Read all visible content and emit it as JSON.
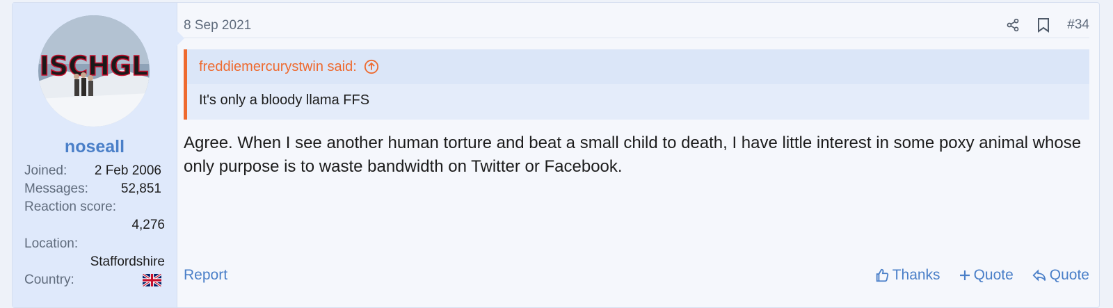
{
  "user": {
    "avatar_text": "ISCHGL",
    "username": "noseall",
    "joined_label": "Joined:",
    "joined_value": "2 Feb 2006",
    "messages_label": "Messages:",
    "messages_value": "52,851",
    "reaction_label": "Reaction score:",
    "reaction_value": "4,276",
    "location_label": "Location:",
    "location_value": "Staffordshire",
    "country_label": "Country:",
    "country_flag": "uk-flag-icon"
  },
  "post": {
    "date": "8 Sep 2021",
    "number": "#34",
    "header_icons": [
      "share-icon",
      "bookmark-icon"
    ]
  },
  "quote": {
    "author": "freddiemercurystwin said:",
    "text": "It's only a bloody llama FFS"
  },
  "message": "Agree. When I see another human torture and beat a small child to death, I have little interest in some poxy animal whose only purpose is to waste bandwidth on Twitter or Facebook.",
  "actions": {
    "report": "Report",
    "thanks": "Thanks",
    "multi_quote": "Quote",
    "quote": "Quote"
  },
  "colors": {
    "accent": "#4a7fc8",
    "quote_accent": "#ee6a2f",
    "user_bg": "#dfe9fb"
  }
}
